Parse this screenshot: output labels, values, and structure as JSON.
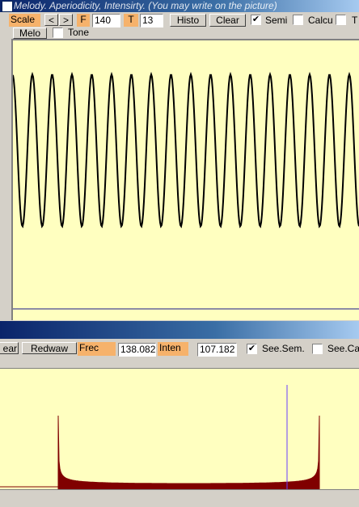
{
  "window": {
    "title": "Melody. Aperiodicity, Intensirty. (You may write on the picture)"
  },
  "toolbar": {
    "scale_label": "Scale",
    "prev_label": "<",
    "next_label": ">",
    "f_label": "F",
    "f_value": "140",
    "t_label": "T",
    "t_value": "13",
    "histo_label": "Histo",
    "clear_label": "Clear",
    "semi": {
      "label": "Semi",
      "checked": true
    },
    "calcu": {
      "label": "Calcu",
      "checked": false
    },
    "t_check": {
      "label": "T",
      "checked": false
    },
    "melo_label": "Melo",
    "tone": {
      "label": "Tone",
      "checked": false
    }
  },
  "toolbar2": {
    "clear_label": "ear",
    "redwaw_label": "Redwaw",
    "frec_label": "Frec",
    "frec_value": "138.082",
    "inten_label": "Inten",
    "inten_value": "107.182",
    "see_sem": {
      "label": "See.Sem.",
      "checked": true
    },
    "see_ca": {
      "label": "See.Ca",
      "checked": false
    }
  },
  "chart_data": [
    {
      "type": "line",
      "series": [
        {
          "values": "sinusoidal waveform, ~17.5 cycles visible"
        }
      ]
    },
    {
      "type": "area",
      "series": [
        {
          "values": "U-shaped amplitude histogram"
        }
      ]
    }
  ],
  "colors": {
    "panel": "#ffffc0",
    "waveform": "#000000",
    "histogram": "#800000",
    "marker": "#6a3cff"
  }
}
